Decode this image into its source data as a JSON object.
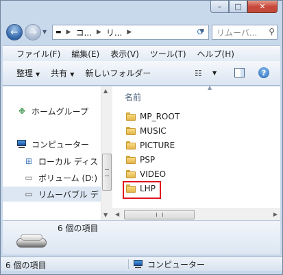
{
  "titlebar": {
    "buttons": [
      "minimize-icon",
      "maximize-icon",
      "close-icon"
    ],
    "minimize_glyph": "–",
    "maximize_glyph": "□",
    "close_glyph": "✕"
  },
  "nav": {
    "back_glyph": "←",
    "forward_glyph": "→",
    "address_segments": [
      "コ...",
      "リ..."
    ],
    "refresh_glyph": "⟳",
    "search_placeholder": "リムーバ..."
  },
  "menu": [
    "ファイル(F)",
    "編集(E)",
    "表示(V)",
    "ツール(T)",
    "ヘルプ(H)"
  ],
  "toolbar": {
    "organize": "整理",
    "share": "共有",
    "new_folder": "新しいフォルダー"
  },
  "nav_pane": {
    "items": [
      {
        "label": "ホームグループ",
        "icon": "homegroup-icon"
      },
      {
        "label": "コンピューター",
        "icon": "computer-icon"
      },
      {
        "label": "ローカル ディス",
        "icon": "local-disk-icon"
      },
      {
        "label": "ボリューム (D:)",
        "icon": "volume-icon"
      },
      {
        "label": "リムーバブル デ",
        "icon": "removable-disk-icon"
      }
    ]
  },
  "files": {
    "column_header": "名前",
    "items": [
      "MP_ROOT",
      "MUSIC",
      "PICTURE",
      "PSP",
      "VIDEO",
      "LHP"
    ]
  },
  "details": {
    "item_count": "6 個の項目"
  },
  "status": {
    "left": "6 個の項目",
    "right": "コンピューター"
  },
  "colors": {
    "window_frame": "#c9d9ec",
    "highlight_box": "#e0141e",
    "folder": "#f9dc82"
  }
}
